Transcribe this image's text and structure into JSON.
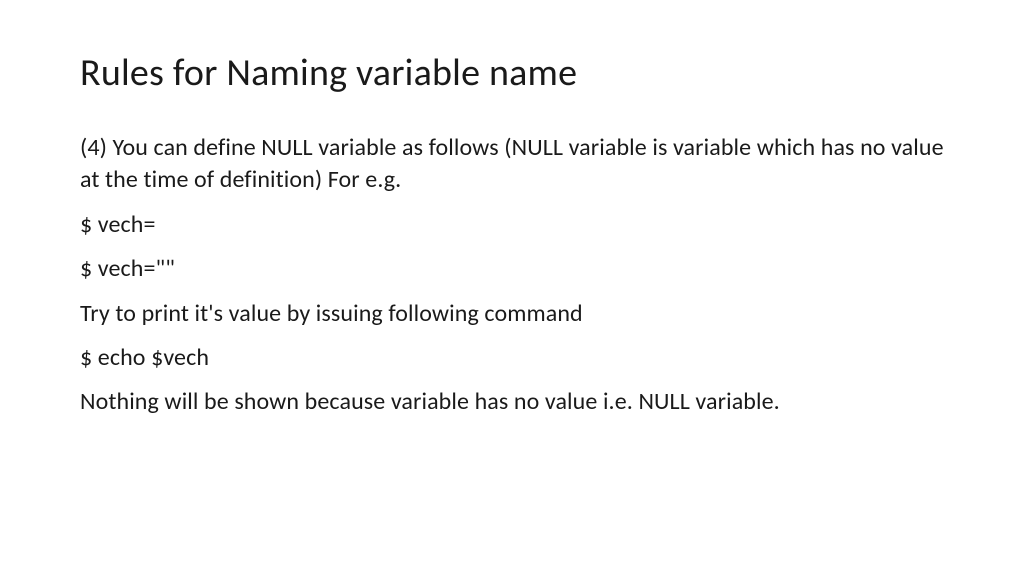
{
  "slide": {
    "title": "Rules for Naming variable name",
    "lines": [
      "(4) You can define NULL variable as follows (NULL variable is variable which has no value at the time of definition) For e.g.",
      "$ vech=",
      "$ vech=\"\"",
      "Try to print it's value by issuing following command",
      "$ echo $vech",
      "Nothing will be shown because variable has no value i.e. NULL variable."
    ]
  }
}
